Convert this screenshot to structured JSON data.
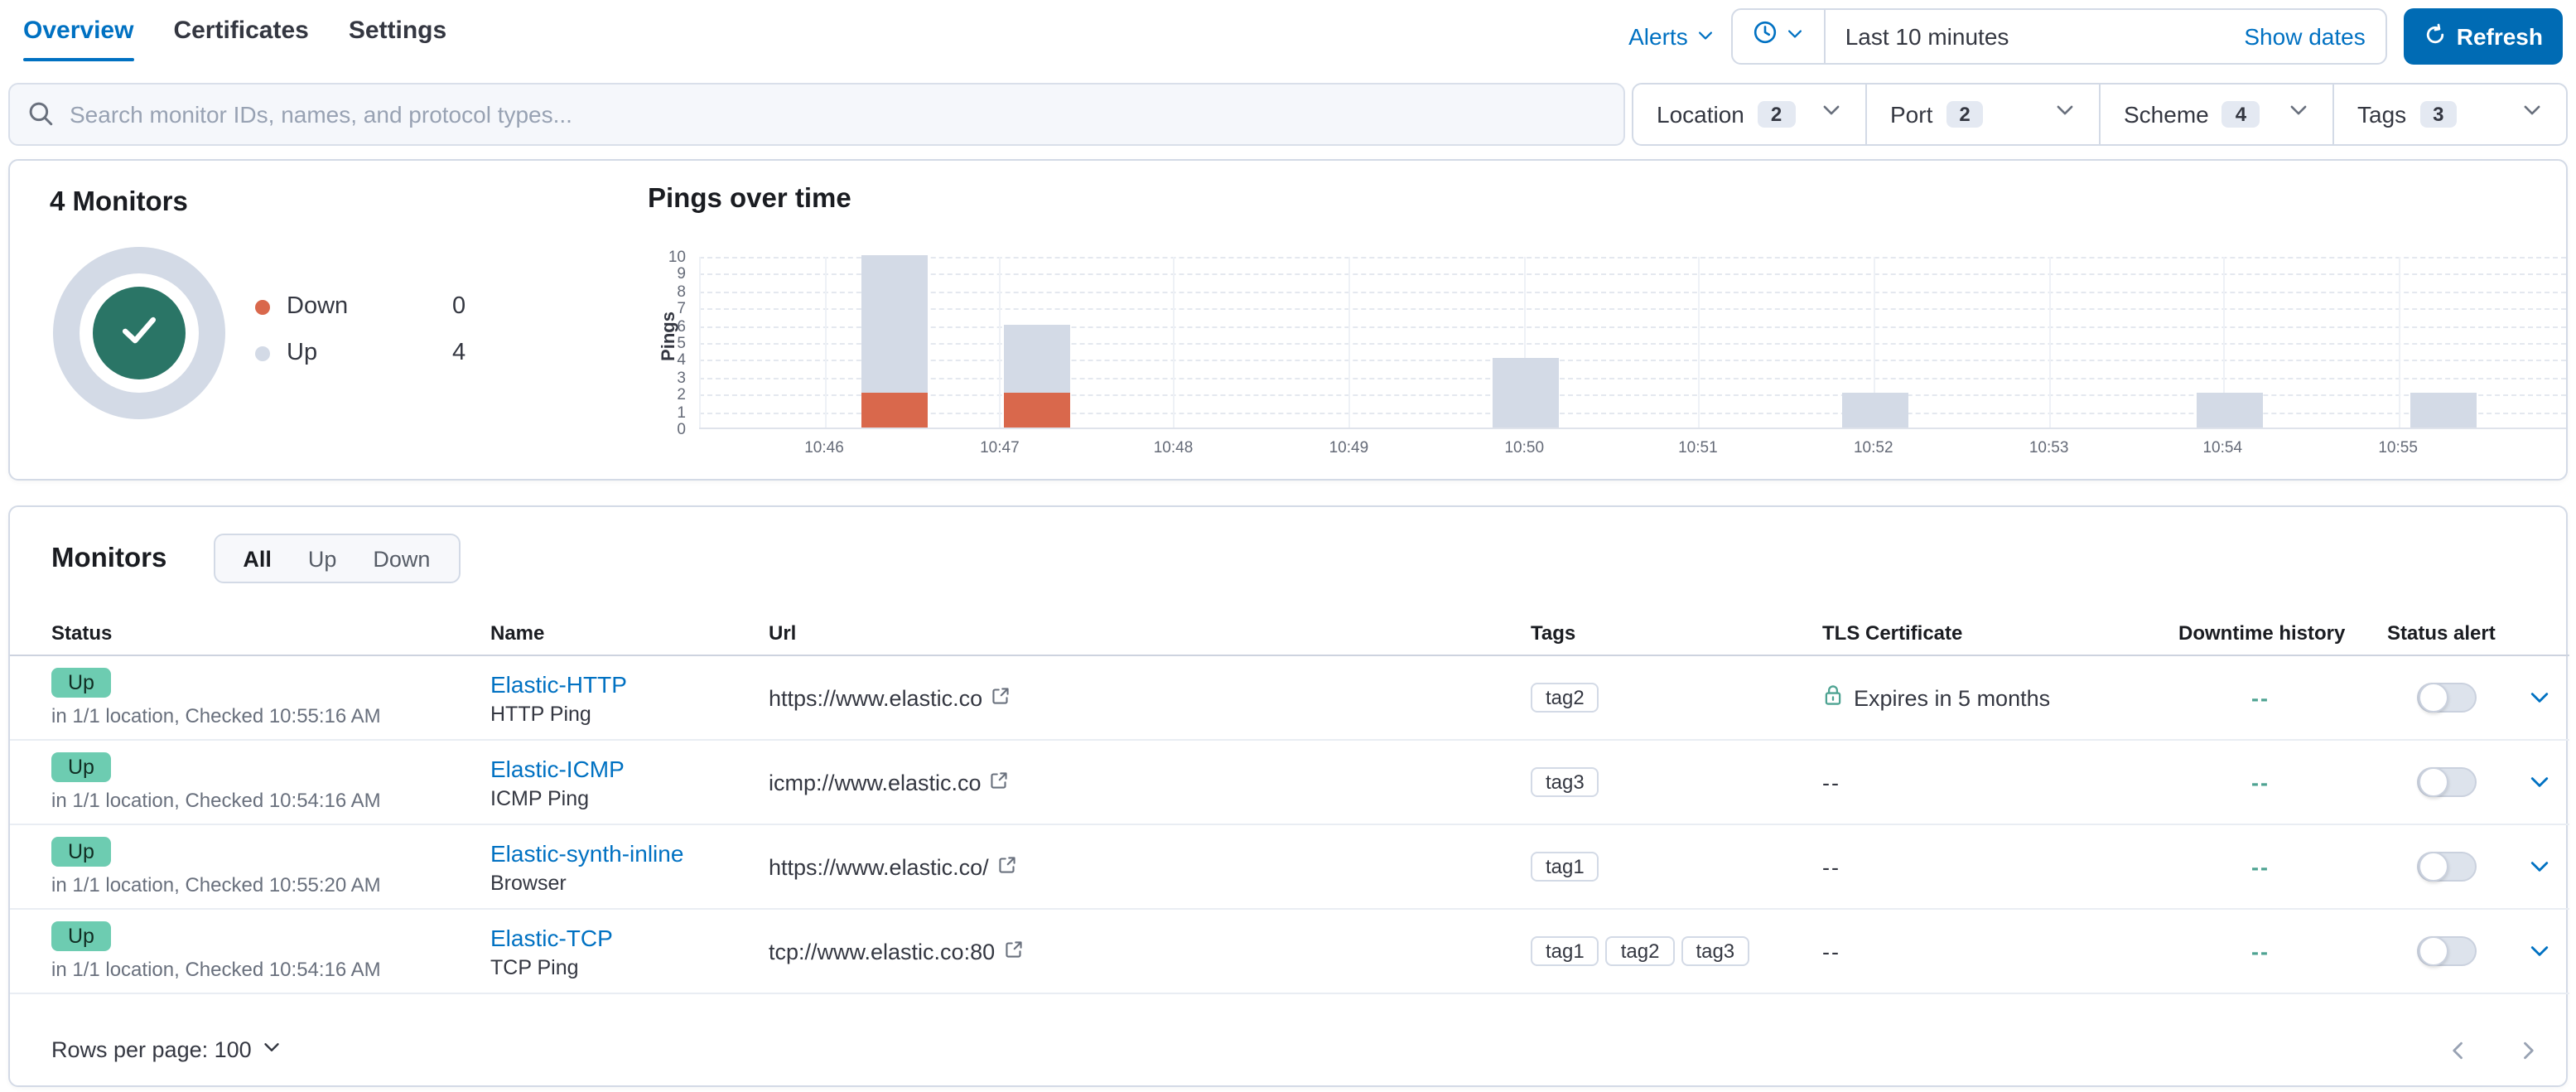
{
  "header": {
    "tabs": [
      {
        "label": "Overview",
        "active": true
      },
      {
        "label": "Certificates",
        "active": false
      },
      {
        "label": "Settings",
        "active": false
      }
    ],
    "alerts_label": "Alerts",
    "time_picker": {
      "range_label": "Last 10 minutes",
      "show_dates_label": "Show dates"
    },
    "refresh_label": "Refresh"
  },
  "search": {
    "placeholder": "Search monitor IDs, names, and protocol types..."
  },
  "filters": [
    {
      "label": "Location",
      "count": "2"
    },
    {
      "label": "Port",
      "count": "2"
    },
    {
      "label": "Scheme",
      "count": "4"
    },
    {
      "label": "Tags",
      "count": "3"
    }
  ],
  "summary": {
    "title": "4 Monitors",
    "legend": [
      {
        "label": "Down",
        "value": "0",
        "color": "#d9684c"
      },
      {
        "label": "Up",
        "value": "4",
        "color": "#d3dae6"
      }
    ],
    "donut": {
      "up_color": "#d3dae6",
      "center_color": "#2a7566"
    }
  },
  "chart_data": {
    "type": "bar",
    "stacked": true,
    "title": "Pings over time",
    "ylabel": "Pings",
    "ylim": [
      0,
      10
    ],
    "y_ticks": [
      0,
      1,
      2,
      3,
      4,
      5,
      6,
      7,
      8,
      9,
      10
    ],
    "x_tick_labels": [
      "10:46",
      "10:47",
      "10:48",
      "10:49",
      "10:50",
      "10:51",
      "10:52",
      "10:53",
      "10:54",
      "10:55"
    ],
    "x_tick_pos": [
      0.067,
      0.161,
      0.254,
      0.348,
      0.442,
      0.535,
      0.629,
      0.723,
      0.816,
      0.91
    ],
    "series": [
      {
        "name": "Up",
        "color": "#d3dae6"
      },
      {
        "name": "Down",
        "color": "#d9684c"
      }
    ],
    "bars": [
      {
        "time": "10:46:30",
        "up": 8,
        "down": 2,
        "pos": 0.105
      },
      {
        "time": "10:47:10",
        "up": 4,
        "down": 2,
        "pos": 0.181
      },
      {
        "time": "10:50:00",
        "up": 4,
        "down": 0,
        "pos": 0.443
      },
      {
        "time": "10:52:00",
        "up": 2,
        "down": 0,
        "pos": 0.63
      },
      {
        "time": "10:54:00",
        "up": 2,
        "down": 0,
        "pos": 0.82
      },
      {
        "time": "10:55:10",
        "up": 2,
        "down": 0,
        "pos": 0.934
      }
    ]
  },
  "monitors": {
    "title": "Monitors",
    "filter_tabs": [
      {
        "label": "All",
        "active": true
      },
      {
        "label": "Up",
        "active": false
      },
      {
        "label": "Down",
        "active": false
      }
    ],
    "columns": [
      "Status",
      "Name",
      "Url",
      "Tags",
      "TLS Certificate",
      "Downtime history",
      "Status alert"
    ],
    "rows": [
      {
        "status": "Up",
        "status_detail": "in 1/1 location, Checked 10:55:16 AM",
        "name": "Elastic-HTTP",
        "type": "HTTP Ping",
        "url": "https://www.elastic.co",
        "tags": [
          "tag2"
        ],
        "tls": "Expires in 5 months",
        "tls_has_cert": true,
        "downtime": "--",
        "alert_on": false
      },
      {
        "status": "Up",
        "status_detail": "in 1/1 location, Checked 10:54:16 AM",
        "name": "Elastic-ICMP",
        "type": "ICMP Ping",
        "url": "icmp://www.elastic.co",
        "tags": [
          "tag3"
        ],
        "tls": "--",
        "tls_has_cert": false,
        "downtime": "--",
        "alert_on": false
      },
      {
        "status": "Up",
        "status_detail": "in 1/1 location, Checked 10:55:20 AM",
        "name": "Elastic-synth-inline",
        "type": "Browser",
        "url": "https://www.elastic.co/",
        "tags": [
          "tag1"
        ],
        "tls": "--",
        "tls_has_cert": false,
        "downtime": "--",
        "alert_on": false
      },
      {
        "status": "Up",
        "status_detail": "in 1/1 location, Checked 10:54:16 AM",
        "name": "Elastic-TCP",
        "type": "TCP Ping",
        "url": "tcp://www.elastic.co:80",
        "tags": [
          "tag1",
          "tag2",
          "tag3"
        ],
        "tls": "--",
        "tls_has_cert": false,
        "downtime": "--",
        "alert_on": false
      }
    ],
    "footer": {
      "rows_per_page_label": "Rows per page: 100"
    }
  },
  "colors": {
    "primary": "#0071c2",
    "button": "#006bb4",
    "up_badge": "#6dccb1",
    "down": "#d9684c",
    "up_gray": "#d3dae6",
    "teal": "#4ea392",
    "border": "#d3dae6"
  }
}
